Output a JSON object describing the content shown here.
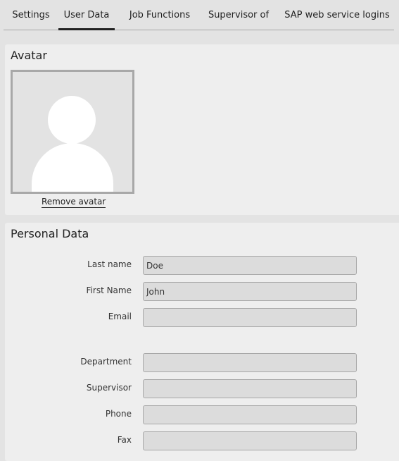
{
  "tabs": [
    {
      "label": "Settings",
      "active": false
    },
    {
      "label": "User Data",
      "active": true
    },
    {
      "label": "Job Functions",
      "active": false
    },
    {
      "label": "Supervisor of",
      "active": false
    },
    {
      "label": "SAP web service logins",
      "active": false
    }
  ],
  "avatar_section": {
    "title": "Avatar",
    "remove_label": "Remove avatar",
    "icon": "user-silhouette-icon"
  },
  "personal_section": {
    "title": "Personal Data",
    "fields": [
      {
        "label": "Last name",
        "value": "Doe"
      },
      {
        "label": "First Name",
        "value": "John"
      },
      {
        "label": "Email",
        "value": ""
      },
      {
        "label": "Department",
        "value": ""
      },
      {
        "label": "Supervisor",
        "value": ""
      },
      {
        "label": "Phone",
        "value": ""
      },
      {
        "label": "Fax",
        "value": ""
      }
    ]
  }
}
